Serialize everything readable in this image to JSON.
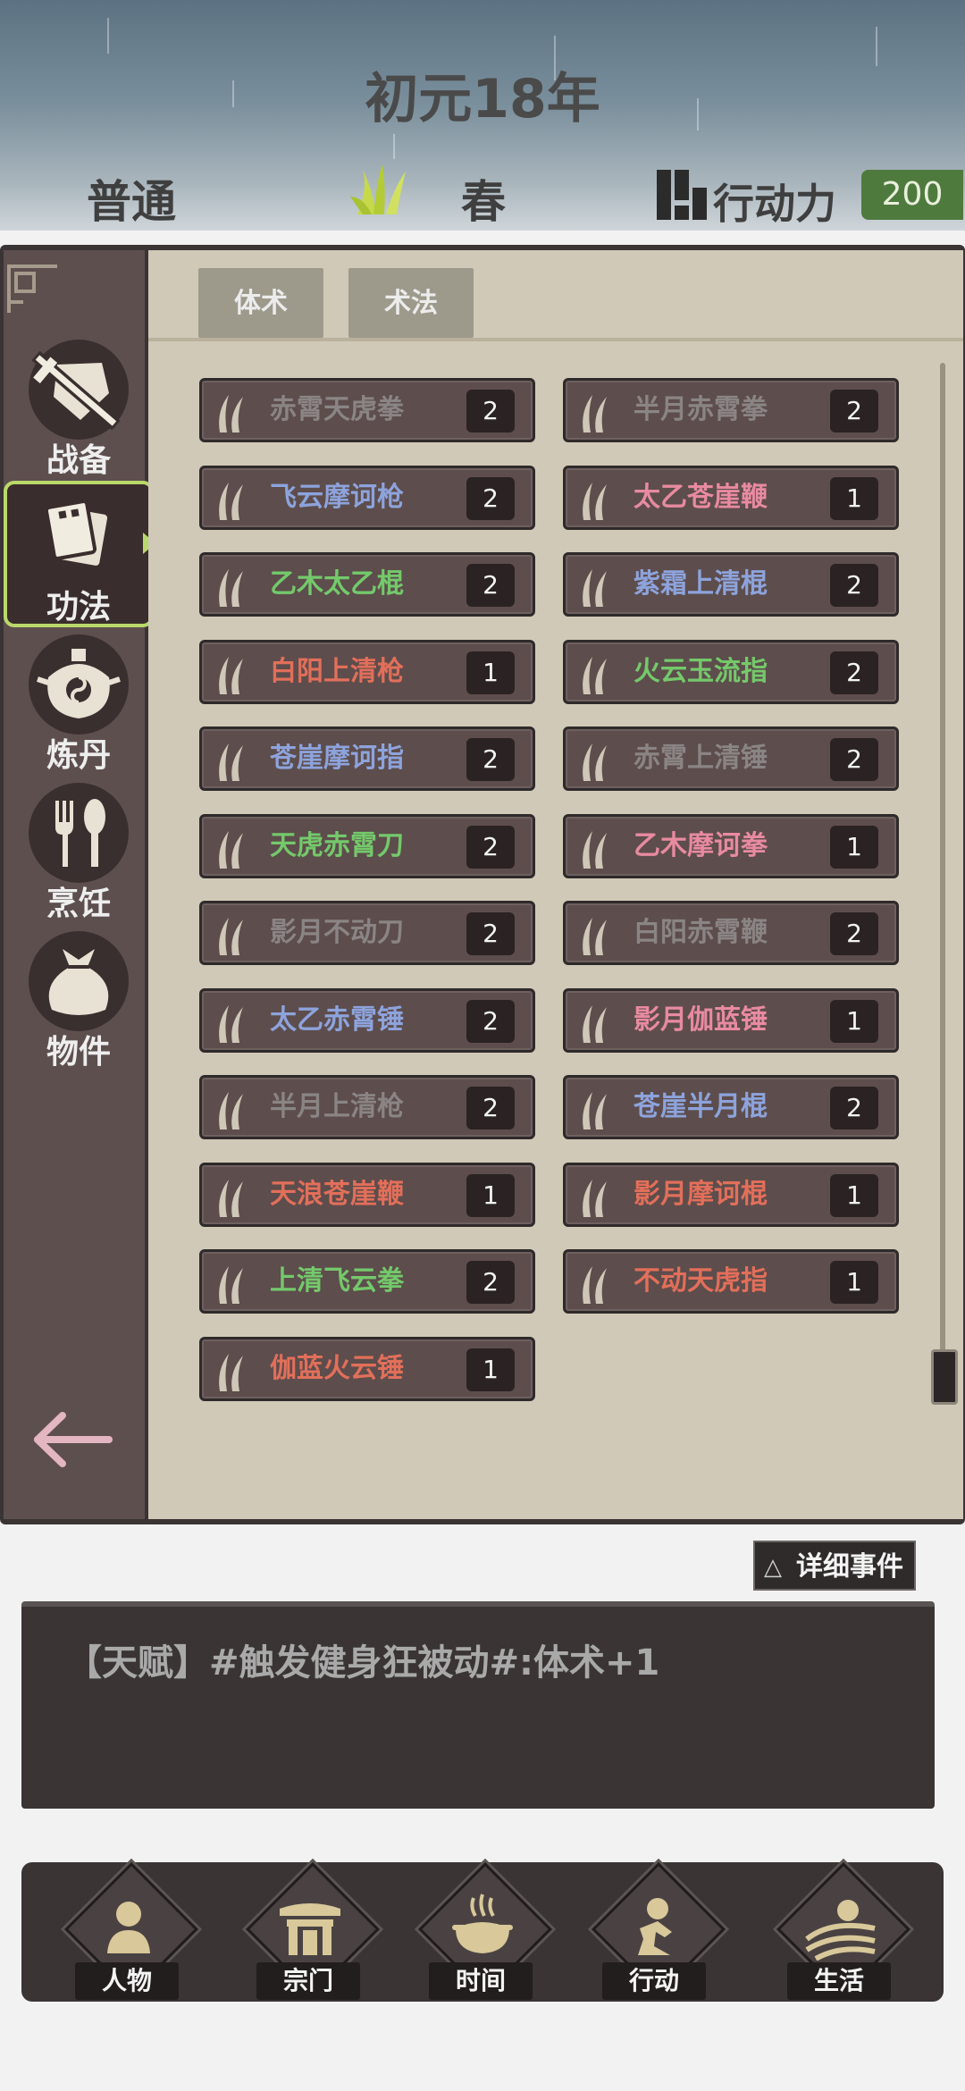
{
  "header": {
    "year": "初元18年",
    "mode": "普通",
    "season": "春",
    "action_label": "行动力",
    "action_value": "200"
  },
  "sidebar": {
    "items": [
      {
        "label": "战备",
        "icon": "sword-shield-icon"
      },
      {
        "label": "功法",
        "icon": "scroll-book-icon",
        "active": true
      },
      {
        "label": "炼丹",
        "icon": "alchemy-cauldron-icon"
      },
      {
        "label": "烹饪",
        "icon": "cooking-utensils-icon"
      },
      {
        "label": "物件",
        "icon": "item-bag-icon"
      }
    ],
    "back_icon": "back-arrow-icon"
  },
  "tabs": [
    "体术",
    "术法"
  ],
  "skills_left": [
    {
      "name": "赤霄天虎拳",
      "count": "2",
      "color": "#8a8584"
    },
    {
      "name": "飞云摩诃枪",
      "count": "2",
      "color": "#8da3dc"
    },
    {
      "name": "乙木太乙棍",
      "count": "2",
      "color": "#74c96b"
    },
    {
      "name": "白阳上清枪",
      "count": "1",
      "color": "#e26f5a"
    },
    {
      "name": "苍崖摩诃指",
      "count": "2",
      "color": "#8da3dc"
    },
    {
      "name": "天虎赤霄刀",
      "count": "2",
      "color": "#74c96b"
    },
    {
      "name": "影月不动刀",
      "count": "2",
      "color": "#8a8584"
    },
    {
      "name": "太乙赤霄锤",
      "count": "2",
      "color": "#8da3dc"
    },
    {
      "name": "半月上清枪",
      "count": "2",
      "color": "#8a8584"
    },
    {
      "name": "天浪苍崖鞭",
      "count": "1",
      "color": "#e26f5a"
    },
    {
      "name": "上清飞云拳",
      "count": "2",
      "color": "#74c96b"
    },
    {
      "name": "伽蓝火云锤",
      "count": "1",
      "color": "#e26f5a"
    }
  ],
  "skills_right": [
    {
      "name": "半月赤霄拳",
      "count": "2",
      "color": "#8a8584"
    },
    {
      "name": "太乙苍崖鞭",
      "count": "1",
      "color": "#e88aa0"
    },
    {
      "name": "紫霜上清棍",
      "count": "2",
      "color": "#8da3dc"
    },
    {
      "name": "火云玉流指",
      "count": "2",
      "color": "#74c96b"
    },
    {
      "name": "赤霄上清锤",
      "count": "2",
      "color": "#8a8584"
    },
    {
      "name": "乙木摩诃拳",
      "count": "1",
      "color": "#e88aa0"
    },
    {
      "name": "白阳赤霄鞭",
      "count": "2",
      "color": "#8a8584"
    },
    {
      "name": "影月伽蓝锤",
      "count": "1",
      "color": "#e88aa0"
    },
    {
      "name": "苍崖半月棍",
      "count": "2",
      "color": "#8da3dc"
    },
    {
      "name": "影月摩诃棍",
      "count": "1",
      "color": "#e26f5a"
    },
    {
      "name": "不动天虎指",
      "count": "1",
      "color": "#e26f5a"
    }
  ],
  "log": {
    "detail_button": "详细事件",
    "detail_icon": "triangle-up-icon",
    "line": "【天赋】#触发健身狂被动#:体术+1"
  },
  "nav": [
    {
      "label": "人物",
      "icon": "person-icon"
    },
    {
      "label": "宗门",
      "icon": "sect-gate-icon"
    },
    {
      "label": "时间",
      "icon": "incense-burner-icon"
    },
    {
      "label": "行动",
      "icon": "action-figure-icon"
    },
    {
      "label": "生活",
      "icon": "landscape-sun-icon"
    }
  ]
}
